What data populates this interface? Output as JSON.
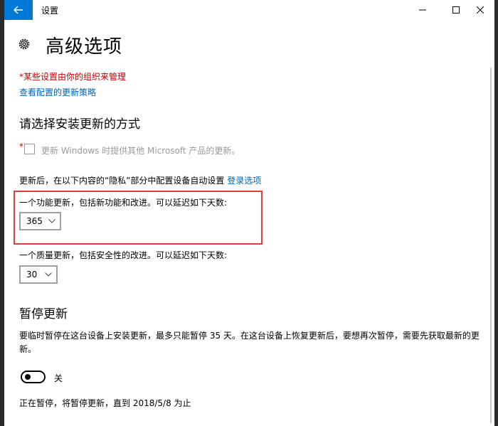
{
  "window": {
    "title": "设置"
  },
  "header": {
    "title": "高级选项"
  },
  "managed_notice": "*某些设置由你的组织来管理",
  "policy_link": "查看配置的更新策略",
  "install_section": {
    "title": "请选择安装更新的方式",
    "checkbox_star": "*",
    "checkbox_label": "更新 Windows 时提供其他 Microsoft 产品的更新。",
    "sign_in_text": "更新后，在以下内容的“隐私”部分中配置设备自动设置",
    "sign_in_link": "登录选项"
  },
  "feature_update": {
    "label": "一个功能更新，包括新功能和改进。可以延迟如下天数:",
    "value": "365"
  },
  "quality_update": {
    "label": "一个质量更新，包括安全性的改进。可以延迟如下天数:",
    "value": "30"
  },
  "pause_section": {
    "title": "暂停更新",
    "description": "要临时暂停在这台设备上安装更新，最多只能暂停 35 天。在这台设备上恢复更新后，要想再次暂停，需要先获取最新的更新。",
    "toggle_label": "关",
    "status": "正在暂停，将暂停更新，直到 2018/5/8 为止"
  },
  "colors": {
    "accent": "#0078d7",
    "link": "#0063b1",
    "warning": "#c00000",
    "highlight_box": "#e03c3c"
  },
  "icons": {
    "back": "arrow-left-icon",
    "settings": "gear-icon",
    "minimize": "minimize-icon",
    "maximize": "maximize-icon",
    "close": "close-icon",
    "dropdown": "chevron-down-icon"
  }
}
